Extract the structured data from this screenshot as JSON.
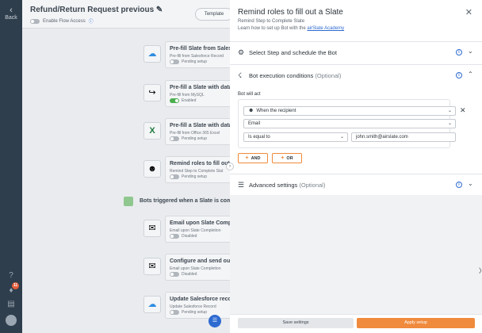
{
  "rail": {
    "back_label": "Back"
  },
  "background": {
    "title": "Refund/Return Request previous",
    "edit_icon": "pencil-icon",
    "enable_label": "Enable Flow Access",
    "template_button": "Template",
    "cards": [
      {
        "title": "Pre-fill Slate from Salesf",
        "sub": "Pre-fill from Salesforce Record",
        "status": "Pending setup",
        "enabled": false,
        "icon": "salesforce-icon"
      },
      {
        "title": "Pre-fill a Slate with data",
        "sub": "Pre-fill from MySQL",
        "status": "Enabled",
        "enabled": true,
        "icon": "mysql-icon"
      },
      {
        "title": "Pre-fill a Slate with data",
        "sub": "Pre-fill from Office 365 Excel",
        "status": "Pending setup",
        "enabled": false,
        "icon": "excel-icon"
      },
      {
        "title": "Remind roles to fill out a",
        "sub": "Remind Step to Complete Slat",
        "status": "Pending setup",
        "enabled": false,
        "icon": "remind-roles-icon"
      },
      {
        "title": "Email upon Slate Comple",
        "sub": "Email upon Slate Completion",
        "status": "Disabled",
        "enabled": false,
        "icon": "email-icon"
      },
      {
        "title": "Configure and send out",
        "sub": "Email upon Slate Completion",
        "status": "Disabled",
        "enabled": false,
        "icon": "email-icon"
      },
      {
        "title": "Update Salesforce reco",
        "sub": "Update Salesforce Record",
        "status": "Pending setup",
        "enabled": false,
        "icon": "salesforce-icon"
      }
    ],
    "section_label": "Bots triggered when a Slate is com",
    "notification_count": "11"
  },
  "panel": {
    "title": "Remind roles to fill out a Slate",
    "subtitle": "Remind Step to Complete Slate",
    "learn_prefix": "Learn how to set up Bot with the ",
    "learn_link": "airSlate Academy",
    "sections": {
      "schedule": {
        "label": "Select Step and schedule the Bot"
      },
      "conditions": {
        "label": "Bot execution conditions",
        "optional": "(Optional)"
      },
      "advanced": {
        "label": "Advanced settings",
        "optional": "(Optional)"
      }
    },
    "bot_will_act": "Bot will act",
    "condition": {
      "subject": "When the recipient",
      "field": "Email",
      "operator": "Is equal to",
      "value": "john.smith@airslate.com"
    },
    "and_button": "AND",
    "or_button": "OR",
    "save_button": "Save settings",
    "apply_button": "Apply setup"
  },
  "colors": {
    "accent": "#f08a3c",
    "link": "#2e6bd1",
    "rail": "#2f3e4c"
  }
}
